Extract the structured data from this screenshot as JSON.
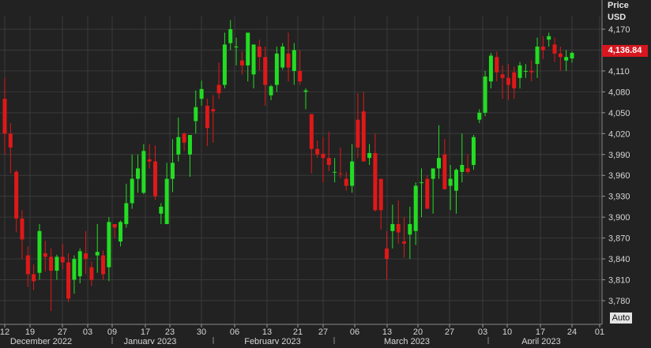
{
  "chart_data": {
    "type": "candlestick",
    "price_axis_title": "Price",
    "currency": "USD",
    "last_price_label": "4,136.84",
    "y_ticks": [
      "4,170",
      "4,140",
      "4,110",
      "4,080",
      "4,050",
      "4,020",
      "3,990",
      "3,960",
      "3,930",
      "3,900",
      "3,870",
      "3,840",
      "3,810",
      "3,780"
    ],
    "y_tick_values": [
      4170,
      4140,
      4110,
      4080,
      4050,
      4020,
      3990,
      3960,
      3930,
      3900,
      3870,
      3840,
      3810,
      3780
    ],
    "ylim": [
      3755,
      4190
    ],
    "x_ticks": [
      "12",
      "19",
      "27",
      "03",
      "09",
      "17",
      "23",
      "30",
      "06",
      "13",
      "21",
      "27",
      "06",
      "13",
      "20",
      "27",
      "03",
      "10",
      "17",
      "24",
      "01"
    ],
    "months": [
      "December 2022",
      "January 2023",
      "February 2023",
      "March 2023",
      "April 2023"
    ],
    "auto_label": "Auto",
    "colors": {
      "up": "#22dd22",
      "down": "#e01818",
      "background": "#222222",
      "grid": "#3a3a3a",
      "last_price": "#d7171f"
    },
    "candles": [
      [
        4070,
        4100,
        3990,
        4020
      ],
      [
        4020,
        4035,
        3963,
        4000
      ],
      [
        3965,
        3968,
        3878,
        3898
      ],
      [
        3898,
        3910,
        3840,
        3868
      ],
      [
        3845,
        3858,
        3800,
        3818
      ],
      [
        3818,
        3832,
        3795,
        3808
      ],
      [
        3820,
        3890,
        3810,
        3880
      ],
      [
        3848,
        3866,
        3822,
        3843
      ],
      [
        3843,
        3855,
        3765,
        3823
      ],
      [
        3823,
        3846,
        3810,
        3843
      ],
      [
        3843,
        3862,
        3825,
        3835
      ],
      [
        3835,
        3848,
        3778,
        3783
      ],
      [
        3810,
        3845,
        3790,
        3840
      ],
      [
        3815,
        3855,
        3805,
        3851
      ],
      [
        3848,
        3880,
        3818,
        3840
      ],
      [
        3828,
        3836,
        3801,
        3810
      ],
      [
        3845,
        3890,
        3820,
        3850
      ],
      [
        3845,
        3852,
        3810,
        3818
      ],
      [
        3828,
        3900,
        3808,
        3893
      ],
      [
        3890,
        3890,
        3870,
        3885
      ],
      [
        3865,
        3895,
        3858,
        3893
      ],
      [
        3890,
        3948,
        3885,
        3920
      ],
      [
        3920,
        3990,
        3912,
        3955
      ],
      [
        3955,
        3990,
        3935,
        3970
      ],
      [
        3935,
        4005,
        3933,
        3995
      ],
      [
        3983,
        4005,
        3970,
        3980
      ],
      [
        3980,
        4003,
        3925,
        3930
      ],
      [
        3905,
        3920,
        3890,
        3915
      ],
      [
        3890,
        3978,
        3890,
        3955
      ],
      [
        3955,
        4012,
        3936,
        3978
      ],
      [
        3990,
        4043,
        3980,
        4015
      ],
      [
        4020,
        4022,
        3995,
        4007
      ],
      [
        3990,
        4018,
        3958,
        4018
      ],
      [
        4038,
        4082,
        4020,
        4058
      ],
      [
        4070,
        4096,
        4060,
        4084
      ],
      [
        4060,
        4070,
        4002,
        4028
      ],
      [
        4055,
        4075,
        4007,
        4052
      ],
      [
        4090,
        4122,
        4070,
        4078
      ],
      [
        4090,
        4165,
        4085,
        4148
      ],
      [
        4150,
        4183,
        4140,
        4170
      ],
      [
        4145,
        4158,
        4118,
        4145
      ],
      [
        4125,
        4138,
        4105,
        4118
      ],
      [
        4118,
        4160,
        4095,
        4165
      ],
      [
        4105,
        4133,
        4085,
        4148
      ],
      [
        4145,
        4155,
        4111,
        4130
      ],
      [
        4130,
        4145,
        4060,
        4090
      ],
      [
        4075,
        4090,
        4068,
        4088
      ],
      [
        4090,
        4145,
        4080,
        4135
      ],
      [
        4115,
        4150,
        4112,
        4145
      ],
      [
        4135,
        4165,
        4095,
        4115
      ],
      [
        4110,
        4150,
        4090,
        4140
      ],
      [
        4110,
        4140,
        4090,
        4095
      ],
      [
        4080,
        4085,
        4055,
        4082
      ],
      [
        4048,
        4048,
        3963,
        3998
      ],
      [
        3998,
        4010,
        3985,
        3990
      ],
      [
        3991,
        4015,
        3950,
        3985
      ],
      [
        3985,
        4023,
        3966,
        3975
      ],
      [
        3965,
        3985,
        3950,
        3965
      ],
      [
        3963,
        4000,
        3956,
        3962
      ],
      [
        3955,
        3965,
        3938,
        3945
      ],
      [
        3945,
        4005,
        3935,
        3980
      ],
      [
        4040,
        4078,
        3985,
        4000
      ],
      [
        4052,
        4080,
        3988,
        3980
      ],
      [
        3985,
        4005,
        3975,
        3992
      ],
      [
        3992,
        4020,
        3908,
        3910
      ],
      [
        3955,
        3925,
        3882,
        3910
      ],
      [
        3855,
        3880,
        3810,
        3840
      ],
      [
        3880,
        3918,
        3855,
        3890
      ],
      [
        3890,
        3924,
        3862,
        3878
      ],
      [
        3865,
        3900,
        3842,
        3862
      ],
      [
        3875,
        3915,
        3840,
        3890
      ],
      [
        3880,
        3950,
        3860,
        3945
      ],
      [
        3950,
        3970,
        3900,
        3950
      ],
      [
        3955,
        3960,
        3915,
        3912
      ],
      [
        3955,
        3970,
        3905,
        3970
      ],
      [
        3970,
        4032,
        3955,
        3985
      ],
      [
        3990,
        4012,
        3963,
        3940
      ],
      [
        3945,
        3975,
        3910,
        3955
      ],
      [
        3938,
        3970,
        3905,
        3968
      ],
      [
        3965,
        4020,
        3950,
        3975
      ],
      [
        3970,
        3990,
        3962,
        3965
      ],
      [
        3975,
        4018,
        3968,
        4015
      ],
      [
        4040,
        4055,
        4035,
        4050
      ],
      [
        4050,
        4110,
        4045,
        4102
      ],
      [
        4095,
        4136,
        4085,
        4132
      ],
      [
        4130,
        4138,
        4095,
        4108
      ],
      [
        4105,
        4118,
        4070,
        4100
      ],
      [
        4100,
        4120,
        4068,
        4090
      ],
      [
        4108,
        4116,
        4070,
        4085
      ],
      [
        4100,
        4123,
        4085,
        4118
      ],
      [
        4110,
        4120,
        4100,
        4110
      ],
      [
        4110,
        4125,
        4095,
        4108
      ],
      [
        4120,
        4158,
        4100,
        4145
      ],
      [
        4145,
        4160,
        4127,
        4140
      ],
      [
        4155,
        4165,
        4145,
        4160
      ],
      [
        4148,
        4158,
        4123,
        4135
      ],
      [
        4135,
        4145,
        4110,
        4130
      ],
      [
        4125,
        4140,
        4110,
        4130
      ],
      [
        4128,
        4138,
        4122,
        4136
      ]
    ]
  }
}
